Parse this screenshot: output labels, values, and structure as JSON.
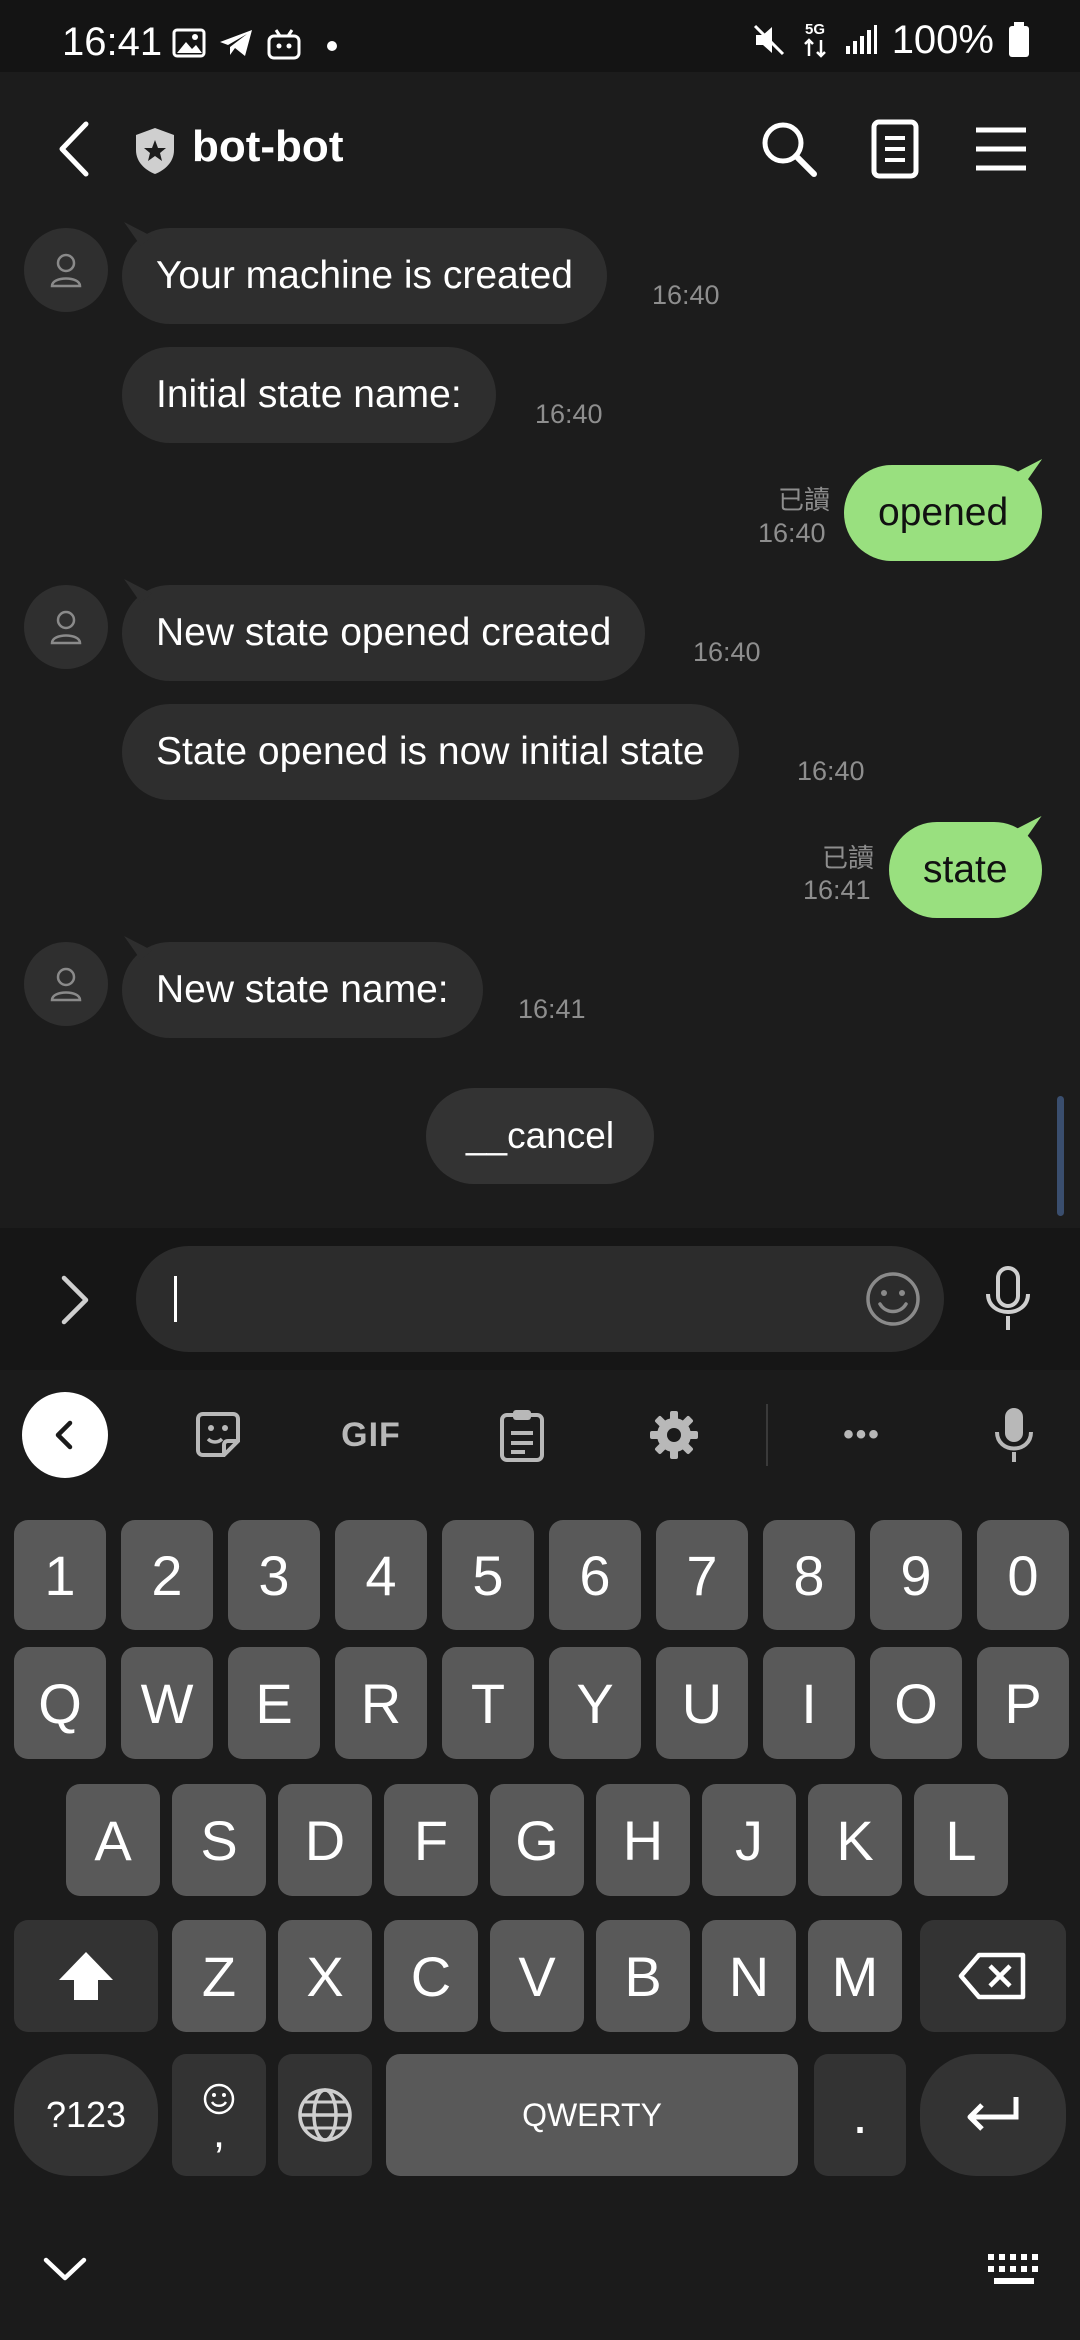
{
  "status_bar": {
    "time": "16:41",
    "network": "5G",
    "battery": "100%"
  },
  "header": {
    "title": "bot-bot"
  },
  "messages": [
    {
      "sender": "bot",
      "text": "Your machine is created",
      "time": "16:40"
    },
    {
      "sender": "bot",
      "text": "Initial state name:",
      "time": "16:40"
    },
    {
      "sender": "me",
      "text": "opened",
      "time": "16:40",
      "read": "已讀"
    },
    {
      "sender": "bot",
      "text": "New state opened created",
      "time": "16:40"
    },
    {
      "sender": "bot",
      "text": "State opened is now initial state",
      "time": "16:40"
    },
    {
      "sender": "me",
      "text": "state",
      "time": "16:41",
      "read": "已讀"
    },
    {
      "sender": "bot",
      "text": "New state name:",
      "time": "16:41"
    }
  ],
  "quick_reply": "__cancel",
  "input": {
    "value": "",
    "placeholder": ""
  },
  "keyboard": {
    "toolbar": {
      "gif": "GIF",
      "more": "•••"
    },
    "rows": [
      [
        "1",
        "2",
        "3",
        "4",
        "5",
        "6",
        "7",
        "8",
        "9",
        "0"
      ],
      [
        "Q",
        "W",
        "E",
        "R",
        "T",
        "Y",
        "U",
        "I",
        "O",
        "P"
      ],
      [
        "A",
        "S",
        "D",
        "F",
        "G",
        "H",
        "J",
        "K",
        "L"
      ],
      [
        "Z",
        "X",
        "C",
        "V",
        "B",
        "N",
        "M"
      ]
    ],
    "symbols_key": "?123",
    "comma_key": ",",
    "space_label": "QWERTY",
    "period_key": "."
  },
  "colors": {
    "my_bubble": "#99e07f",
    "bot_bubble": "#2e2e2e",
    "background": "#1c1c1c"
  }
}
